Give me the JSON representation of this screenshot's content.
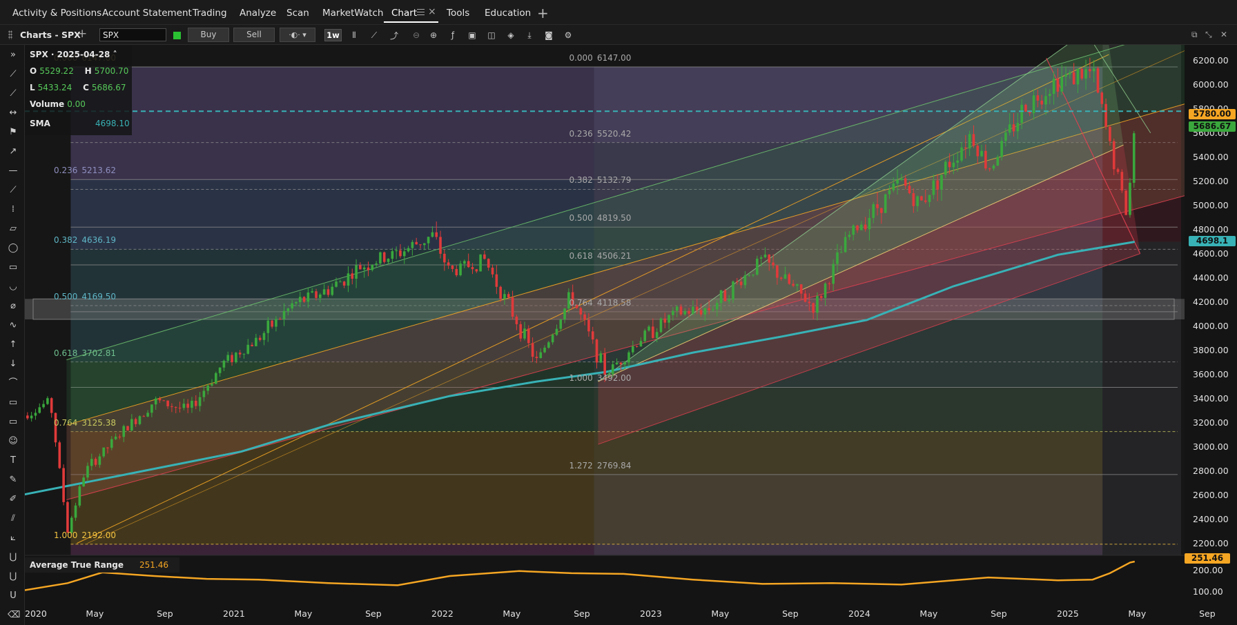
{
  "navbar": {
    "tabs": [
      {
        "label": "Activity & Positions"
      },
      {
        "label": "Account Statement"
      },
      {
        "label": "Trading"
      },
      {
        "label": "Analyze"
      },
      {
        "label": "Scan"
      },
      {
        "label": "MarketWatch"
      },
      {
        "label": "Chart",
        "active": true
      },
      {
        "label": "Tools"
      },
      {
        "label": "Education"
      }
    ]
  },
  "toolbar": {
    "title": "Charts - SPX",
    "symbol": "SPX",
    "buy_label": "Buy",
    "sell_label": "Sell",
    "timeframe": "1w",
    "live_color": "#2ac232"
  },
  "info": {
    "header": "SPX · 2025-04-28",
    "open_k": "O",
    "open": "5529.22",
    "high_k": "H",
    "high": "5700.70",
    "low_k": "L",
    "low": "5433.24",
    "close_k": "C",
    "close": "5686.67",
    "volume_k": "Volume",
    "volume": "0.00",
    "sma_k": "SMA",
    "sma": "4698.10"
  },
  "price_axis": {
    "ticks": [
      "6200.00",
      "6000.00",
      "5800.00",
      "5600.00",
      "5400.00",
      "5200.00",
      "5000.00",
      "4800.00",
      "4600.00",
      "4400.00",
      "4200.00",
      "4000.00",
      "3800.00",
      "3600.00",
      "3400.00",
      "3200.00",
      "3000.00",
      "2800.00",
      "2600.00",
      "2400.00",
      "2200.00"
    ],
    "labels": [
      {
        "text": "5780.00",
        "color": "#f5a623"
      },
      {
        "text": "5686.67",
        "color": "#3aa83d"
      },
      {
        "text": "4698.1",
        "color": "#38b2b6"
      }
    ]
  },
  "fib_left": [
    {
      "ratio": "0.000",
      "price": "6147.00"
    },
    {
      "ratio": "0.236",
      "price": "5213.62"
    },
    {
      "ratio": "0.382",
      "price": "4636.19"
    },
    {
      "ratio": "0.500",
      "price": "4169.50"
    },
    {
      "ratio": "0.618",
      "price": "3702.81"
    },
    {
      "ratio": "0.764",
      "price": "3125.38"
    },
    {
      "ratio": "1.000",
      "price": "2192.00"
    }
  ],
  "fib_right": [
    {
      "ratio": "0.000",
      "price": "6147.00"
    },
    {
      "ratio": "0.236",
      "price": "5520.42"
    },
    {
      "ratio": "0.382",
      "price": "5132.79"
    },
    {
      "ratio": "0.500",
      "price": "4819.50"
    },
    {
      "ratio": "0.618",
      "price": "4506.21"
    },
    {
      "ratio": "0.764",
      "price": "4118.58"
    },
    {
      "ratio": "1.000",
      "price": "3492.00"
    },
    {
      "ratio": "1.272",
      "price": "2769.84"
    }
  ],
  "atr": {
    "title": "Average True Range",
    "value": "251.46",
    "axis_label": "251.46",
    "ticks": [
      "200.00",
      "100.00"
    ]
  },
  "time_axis": [
    "2020",
    "May",
    "Sep",
    "2021",
    "May",
    "Sep",
    "2022",
    "May",
    "Sep",
    "2023",
    "May",
    "Sep",
    "2024",
    "May",
    "Sep",
    "2025",
    "May",
    "Sep"
  ],
  "chart_data": {
    "type": "candlestick",
    "symbol": "SPX",
    "x_range": [
      "2020-01",
      "2025-09"
    ],
    "ylim": [
      2100,
      6330
    ],
    "sma_last": 4698.1,
    "horizontal_line": 5780,
    "price_path": [
      [
        "2019-12",
        3240
      ],
      [
        "2020-01",
        3300
      ],
      [
        "2020-02",
        3380
      ],
      [
        "2020-03",
        2300
      ],
      [
        "2020-04",
        2800
      ],
      [
        "2020-06",
        3100
      ],
      [
        "2020-08",
        3380
      ],
      [
        "2020-10",
        3300
      ],
      [
        "2020-12",
        3700
      ],
      [
        "2021-02",
        3900
      ],
      [
        "2021-04",
        4180
      ],
      [
        "2021-06",
        4300
      ],
      [
        "2021-08",
        4500
      ],
      [
        "2021-10",
        4600
      ],
      [
        "2021-12",
        4750
      ],
      [
        "2022-01",
        4450
      ],
      [
        "2022-03",
        4550
      ],
      [
        "2022-05",
        4000
      ],
      [
        "2022-06",
        3700
      ],
      [
        "2022-08",
        4250
      ],
      [
        "2022-10",
        3600
      ],
      [
        "2022-12",
        3900
      ],
      [
        "2023-02",
        4100
      ],
      [
        "2023-04",
        4150
      ],
      [
        "2023-07",
        4550
      ],
      [
        "2023-10",
        4150
      ],
      [
        "2023-12",
        4750
      ],
      [
        "2024-03",
        5200
      ],
      [
        "2024-04",
        5000
      ],
      [
        "2024-07",
        5600
      ],
      [
        "2024-08",
        5300
      ],
      [
        "2024-10",
        5800
      ],
      [
        "2024-12",
        6050
      ],
      [
        "2025-02",
        6100
      ],
      [
        "2025-03",
        5500
      ],
      [
        "2025-04",
        4900
      ],
      [
        "2025-04-28",
        5686.67
      ]
    ],
    "sma_path": [
      [
        "2019-12",
        2590
      ],
      [
        "2020-06",
        2760
      ],
      [
        "2021-01",
        2960
      ],
      [
        "2021-06",
        3180
      ],
      [
        "2022-01",
        3420
      ],
      [
        "2022-06",
        3540
      ],
      [
        "2022-10",
        3620
      ],
      [
        "2023-03",
        3780
      ],
      [
        "2023-08",
        3910
      ],
      [
        "2024-01",
        4050
      ],
      [
        "2024-06",
        4330
      ],
      [
        "2024-12",
        4590
      ],
      [
        "2025-04-28",
        4698.1
      ]
    ],
    "atr_path": [
      [
        "2019-12",
        40
      ],
      [
        "2020-03",
        100
      ],
      [
        "2020-05",
        175
      ],
      [
        "2020-08",
        150
      ],
      [
        "2020-11",
        130
      ],
      [
        "2021-02",
        125
      ],
      [
        "2021-06",
        100
      ],
      [
        "2021-10",
        85
      ],
      [
        "2022-01",
        150
      ],
      [
        "2022-05",
        185
      ],
      [
        "2022-08",
        170
      ],
      [
        "2022-11",
        165
      ],
      [
        "2023-03",
        125
      ],
      [
        "2023-07",
        95
      ],
      [
        "2023-11",
        100
      ],
      [
        "2024-03",
        90
      ],
      [
        "2024-08",
        140
      ],
      [
        "2024-12",
        120
      ],
      [
        "2025-02",
        125
      ],
      [
        "2025-03",
        170
      ],
      [
        "2025-04-20",
        245
      ],
      [
        "2025-04-28",
        251.46
      ]
    ]
  }
}
